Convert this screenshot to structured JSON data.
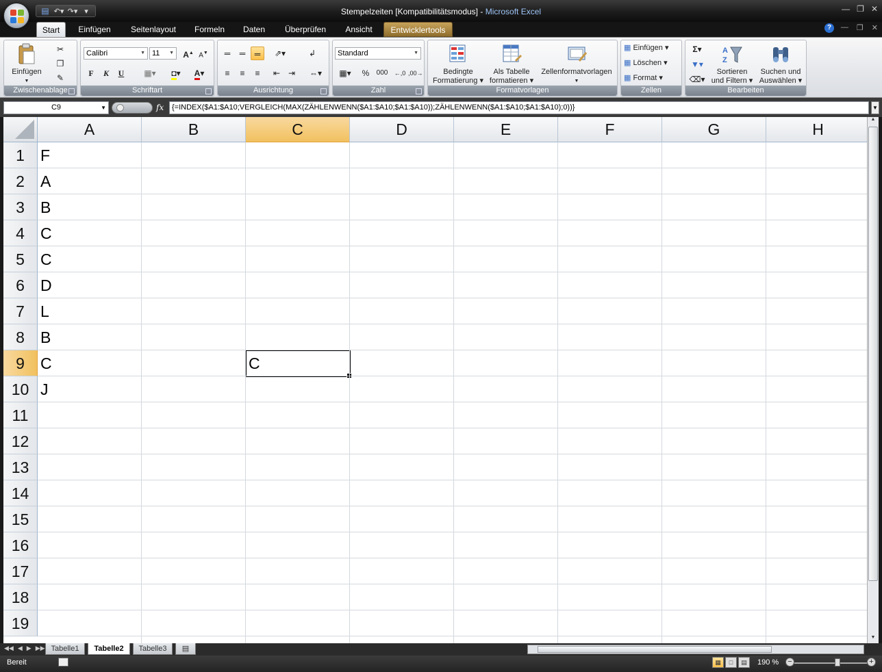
{
  "window": {
    "title_doc": "Stempelzeiten  [Kompatibilitätsmodus]",
    "title_sep": " - ",
    "title_app": "Microsoft Excel"
  },
  "tabs": [
    "Start",
    "Einfügen",
    "Seitenlayout",
    "Formeln",
    "Daten",
    "Überprüfen",
    "Ansicht",
    "Entwicklertools"
  ],
  "ribbon": {
    "clipboard": {
      "label": "Zwischenablage",
      "paste": "Einfügen"
    },
    "font": {
      "label": "Schriftart",
      "name": "Calibri",
      "size": "11",
      "bold": "F",
      "italic": "K",
      "underline": "U"
    },
    "alignment": {
      "label": "Ausrichtung"
    },
    "number": {
      "label": "Zahl",
      "format": "Standard",
      "percent": "%",
      "thousands": "000"
    },
    "styles": {
      "label": "Formatvorlagen",
      "conditional_1": "Bedingte",
      "conditional_2": "Formatierung",
      "table_1": "Als Tabelle",
      "table_2": "formatieren",
      "cellstyles": "Zellenformatvorlagen"
    },
    "cells": {
      "label": "Zellen",
      "insert": "Einfügen",
      "delete": "Löschen",
      "format": "Format"
    },
    "editing": {
      "label": "Bearbeiten",
      "sort_1": "Sortieren",
      "sort_2": "und Filtern",
      "find_1": "Suchen und",
      "find_2": "Auswählen"
    }
  },
  "formula_bar": {
    "name_box": "C9",
    "fx": "fx",
    "formula": "{=INDEX($A1:$A10;VERGLEICH(MAX(ZÄHLENWENN($A1:$A10;$A1:$A10));ZÄHLENWENN($A1:$A10;$A1:$A10);0))}"
  },
  "grid": {
    "columns": [
      "A",
      "B",
      "C",
      "D",
      "E",
      "F",
      "G",
      "H"
    ],
    "rows": [
      "1",
      "2",
      "3",
      "4",
      "5",
      "6",
      "7",
      "8",
      "9",
      "10",
      "11",
      "12",
      "13",
      "14",
      "15",
      "16",
      "17",
      "18",
      "19"
    ],
    "column_a": [
      "F",
      "A",
      "B",
      "C",
      "C",
      "D",
      "L",
      "B",
      "C",
      "J"
    ],
    "selected_column": "C",
    "selected_row": "9",
    "active_cell_value": "C"
  },
  "sheets": [
    "Tabelle1",
    "Tabelle2",
    "Tabelle3"
  ],
  "active_sheet": "Tabelle2",
  "status": {
    "text": "Bereit",
    "zoom": "190 %"
  },
  "colors": {
    "selection_header": "#f1c15f",
    "dev_tab": "#a98640",
    "chrome": "#1c1c1c"
  }
}
